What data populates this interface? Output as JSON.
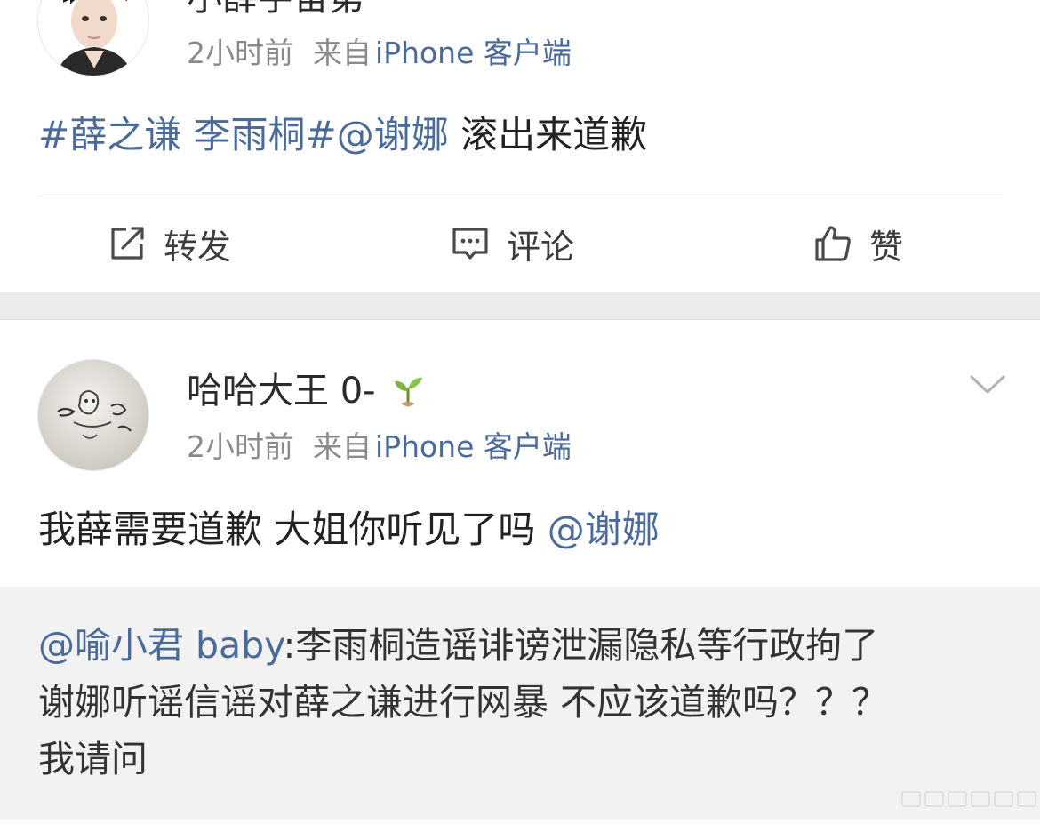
{
  "post1": {
    "username": "小薛宇宙第",
    "time": "2小时前",
    "source_prefix": "来自",
    "client": "iPhone 客户端",
    "content_link": "#薛之谦 李雨桐#@谢娜",
    "content_text": " 滚出来道歉"
  },
  "actions": {
    "repost_label": "转发",
    "comment_label": "评论",
    "like_label": "赞"
  },
  "post2": {
    "username": "哈哈大王 0-",
    "time": "2小时前",
    "source_prefix": "来自",
    "client": "iPhone 客户端",
    "content_text": "我薛需要道歉 大姐你听见了吗 ",
    "content_mention": "@谢娜"
  },
  "quote": {
    "mention": "@喻小君 baby",
    "line1_text": ":李雨桐造谣诽谤泄漏隐私等行政拘了",
    "line2": "谢娜听谣信谣对薛之谦进行网暴 不应该道歉吗？？？",
    "line3": "我请问"
  },
  "colors": {
    "link": "#4a6a9a",
    "meta": "#8a8a8a",
    "quote_bg": "#f2f2f2"
  }
}
